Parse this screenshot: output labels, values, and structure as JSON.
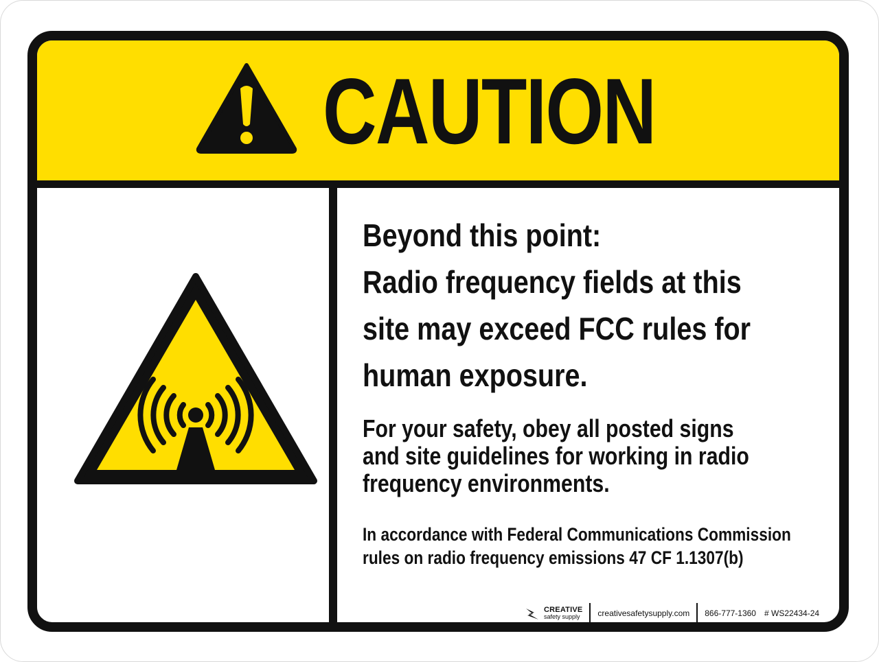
{
  "header": {
    "title": "CAUTION",
    "icon": "warning-triangle-exclamation-icon",
    "color": "#ffde00"
  },
  "symbol": {
    "icon": "non-ionizing-radiation-icon",
    "color": "#ffde00"
  },
  "message": {
    "headline_lines": [
      "Beyond this point:",
      "Radio frequency fields at this",
      "site may exceed FCC rules for",
      "human exposure."
    ],
    "instruction_lines": [
      "For your safety, obey all posted signs",
      "and site guidelines for working in radio",
      "frequency environments."
    ],
    "regulation_lines": [
      "In accordance with Federal Communications Commission",
      "rules on radio frequency emissions 47 CF 1.1307(b)"
    ]
  },
  "footer": {
    "brand_name": "CREATIVE",
    "brand_sub": "safety supply",
    "website": "creativesafetysupply.com",
    "phone": "866-777-1360",
    "product_code": "# WS22434-24"
  }
}
